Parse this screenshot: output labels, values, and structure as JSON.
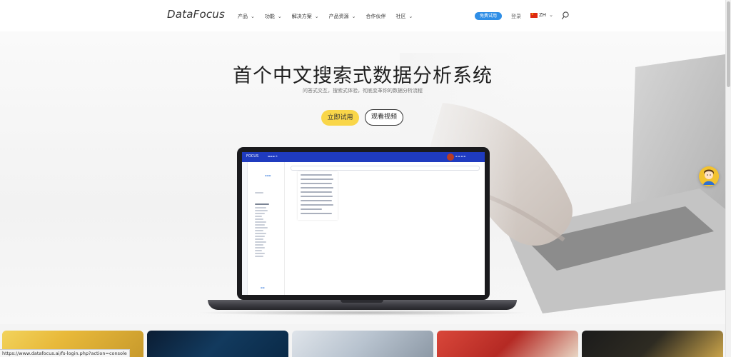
{
  "header": {
    "logo": "DataFocus",
    "nav": [
      {
        "label": "产品",
        "has_dropdown": true
      },
      {
        "label": "功能",
        "has_dropdown": true
      },
      {
        "label": "解决方案",
        "has_dropdown": true
      },
      {
        "label": "产品资源",
        "has_dropdown": true
      },
      {
        "label": "合作伙伴",
        "has_dropdown": false
      },
      {
        "label": "社区",
        "has_dropdown": true
      }
    ],
    "trial_button": "免费试用",
    "login": "登录",
    "language": "ZH",
    "search_icon": "search-icon"
  },
  "hero": {
    "title": "首个中文搜索式数据分析系统",
    "subtitle": "问答式交互，搜索式体验，彻底变革你的数据分析流程",
    "primary_button": "立即试用",
    "secondary_button": "观看视频"
  },
  "app_mock": {
    "logo": "FOCUS"
  },
  "cards": [
    "card-1",
    "card-2",
    "card-3",
    "card-4",
    "card-5"
  ],
  "status_bar": {
    "url": "https://www.datafocus.ai/fs-login.php?action=console"
  },
  "colors": {
    "trial_blue": "#2f8ee6",
    "try_yellow": "#f9d649",
    "app_bar_blue": "#1f3bbf"
  }
}
